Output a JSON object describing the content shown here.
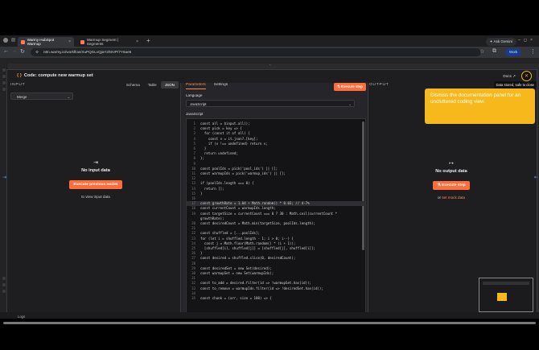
{
  "browser": {
    "tabs": [
      {
        "label": "Warmy HubSpot Warmup",
        "active": true
      },
      {
        "label": "Warmup Segment | Segments",
        "active": false
      }
    ],
    "ask_gemini": "Ask Gemini",
    "url": "n8n.warmy.io/workflow/XuPQGLvQjaY2h5VP/7Y6ae6",
    "work_label": "Work"
  },
  "modal": {
    "title": "Code: compute new warmup set",
    "docs_label": "Docs",
    "tooltip": "Data stored, safe to close"
  },
  "input_panel": {
    "label": "INPUT",
    "view_tabs": [
      "Schema",
      "Table",
      "JSON"
    ],
    "active_view": "JSON",
    "node_select": "Merge",
    "empty_title": "No input data",
    "exec_button": "Execute previous nodes",
    "sub_text": "to view input data"
  },
  "params_panel": {
    "tabs": [
      "Parameters",
      "Settings"
    ],
    "active_tab": "Parameters",
    "execute_step": "Execute step",
    "language_label": "Language",
    "language_value": "JavaScript",
    "code_label": "JavaScript",
    "code_lines": [
      {
        "n": "1",
        "t": "const all = $input.all();"
      },
      {
        "n": "2",
        "t": "const pick = key => {"
      },
      {
        "n": "3",
        "t": "  for (const it of all) {"
      },
      {
        "n": "4",
        "t": "    const v = it.json?.[key];"
      },
      {
        "n": "5",
        "t": "    if (v !== undefined) return v;"
      },
      {
        "n": "6",
        "t": "  }"
      },
      {
        "n": "7",
        "t": "  return undefined;"
      },
      {
        "n": "8",
        "t": "};"
      },
      {
        "n": "9",
        "t": ""
      },
      {
        "n": "10",
        "t": "const poolIds = pick('pool_ids') || [];"
      },
      {
        "n": "11",
        "t": "const warmupIds = pick('warmup_ids') || [];"
      },
      {
        "n": "12",
        "t": ""
      },
      {
        "n": "13",
        "t": "if (poolIds.length === 0) {"
      },
      {
        "n": "14",
        "t": "  return [];"
      },
      {
        "n": "15",
        "t": "}"
      },
      {
        "n": "16",
        "t": ""
      },
      {
        "n": "17",
        "t": "const growthRate = 1.04 + Math.random() * 0.03; // 4-7%"
      },
      {
        "n": "18",
        "t": "const currentCount = warmupIds.length;"
      },
      {
        "n": "19",
        "t": "const targetSize = currentCount === 0 ? 30 : Math.ceil(currentCount *"
      },
      {
        "n": "",
        "t": "growthRate);"
      },
      {
        "n": "20",
        "t": "const desiredCount = Math.min(targetSize, poolIds.length);"
      },
      {
        "n": "21",
        "t": ""
      },
      {
        "n": "22",
        "t": "const shuffled = [...poolIds];"
      },
      {
        "n": "23",
        "t": "for (let i = shuffled.length - 1; i > 0; i--) {"
      },
      {
        "n": "24",
        "t": "  const j = Math.floor(Math.random() * (i + 1));"
      },
      {
        "n": "25",
        "t": "  [shuffled[i], shuffled[j]] = [shuffled[j], shuffled[i]];"
      },
      {
        "n": "26",
        "t": "}"
      },
      {
        "n": "27",
        "t": "const desired = shuffled.slice(0, desiredCount);"
      },
      {
        "n": "28",
        "t": ""
      },
      {
        "n": "29",
        "t": "const desiredSet = new Set(desired);"
      },
      {
        "n": "30",
        "t": "const warmupSet = new Set(warmupIds);"
      },
      {
        "n": "31",
        "t": ""
      },
      {
        "n": "32",
        "t": "const to_add = desired.filter(id => !warmupSet.has(id));"
      },
      {
        "n": "33",
        "t": "const to_remove = warmupIds.filter(id => !desiredSet.has(id));"
      },
      {
        "n": "34",
        "t": ""
      },
      {
        "n": "35",
        "t": "const chunk = (arr, size = 100) => {"
      }
    ],
    "highlight_line": "17"
  },
  "output_panel": {
    "label": "OUTPUT",
    "empty_title": "No output data",
    "exec_button": "Execute step",
    "sub_prefix": "or",
    "sub_link": "set mock data"
  },
  "callout": {
    "text": "Dismiss the documentation panel for an uncluttered coding view."
  },
  "footer": {
    "logs_label": "Logs"
  },
  "colors": {
    "accent": "#ff6d3a",
    "callout": "#f6b81a",
    "modal_bg": "#1e1e21"
  }
}
